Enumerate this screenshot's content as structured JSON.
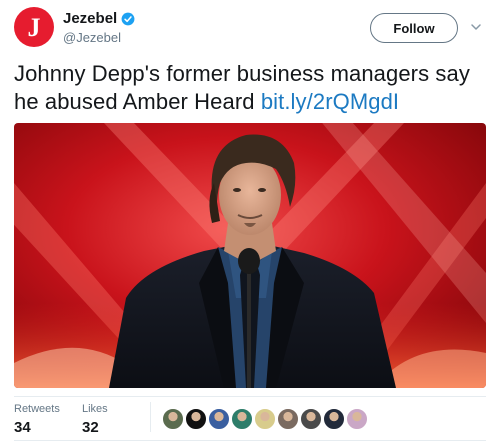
{
  "account": {
    "name": "Jezebel",
    "handle": "@Jezebel",
    "avatar_letter": "J",
    "avatar_color": "#e61c2f",
    "verified_icon": "verified-badge-icon",
    "verified_color": "#1da1f2"
  },
  "follow_button": {
    "label": "Follow"
  },
  "menu_icon": "chevron-down-icon",
  "tweet": {
    "text": "Johnny Depp's former business managers say he abused Amber Heard ",
    "link": "bit.ly/2rQMgdI",
    "link_color": "#1c7ac2"
  },
  "media": {
    "kind": "photo",
    "icon": "photo-icon"
  },
  "stats": {
    "retweets_label": "Retweets",
    "retweets_count": "34",
    "likes_label": "Likes",
    "likes_count": "32"
  },
  "likers": [
    {
      "icon": "liker-avatar-1-icon",
      "color": "#5a6b4e"
    },
    {
      "icon": "liker-avatar-2-icon",
      "color": "#111111"
    },
    {
      "icon": "liker-avatar-3-icon",
      "color": "#3a5fa0"
    },
    {
      "icon": "liker-avatar-4-icon",
      "color": "#2e7d6a"
    },
    {
      "icon": "liker-avatar-5-icon",
      "color": "#d8cc8c"
    },
    {
      "icon": "liker-avatar-6-icon",
      "color": "#7a6a60"
    },
    {
      "icon": "liker-avatar-7-icon",
      "color": "#4a4a4a"
    },
    {
      "icon": "liker-avatar-8-icon",
      "color": "#222a3a"
    },
    {
      "icon": "liker-avatar-9-icon",
      "color": "#caa7c6"
    }
  ]
}
